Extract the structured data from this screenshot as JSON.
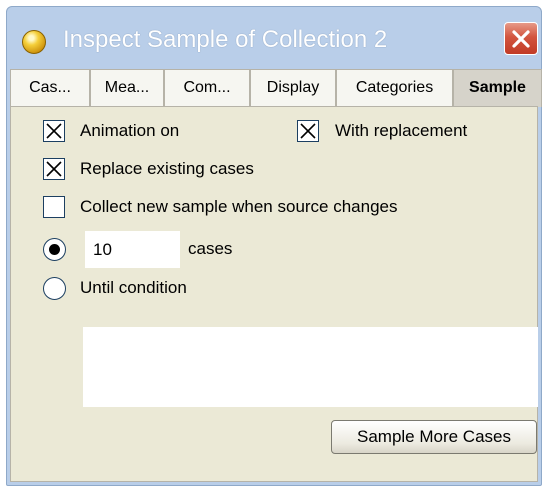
{
  "window": {
    "title": "Inspect Sample of Collection 2",
    "title_icon": "yellow-orb-icon",
    "close_icon": "close-icon",
    "close_color": "#c9442f"
  },
  "tabs": [
    {
      "label": "Cas...",
      "active": false
    },
    {
      "label": "Mea...",
      "active": false
    },
    {
      "label": "Com...",
      "active": false
    },
    {
      "label": "Display",
      "active": false
    },
    {
      "label": "Categories",
      "active": false
    },
    {
      "label": "Sample",
      "active": true
    }
  ],
  "options": {
    "animation_label": "Animation on",
    "animation_checked": true,
    "replacement_label": "With replacement",
    "replacement_checked": true,
    "replace_label": "Replace existing cases",
    "replace_checked": true,
    "collect_label": "Collect new sample when source changes",
    "collect_checked": false
  },
  "size": {
    "cases_value": "10",
    "cases_label": "cases",
    "cases_selected": true,
    "until_label": "Until condition",
    "until_selected": false,
    "condition_value": ""
  },
  "actions": {
    "sample_more_label": "Sample More Cases"
  }
}
